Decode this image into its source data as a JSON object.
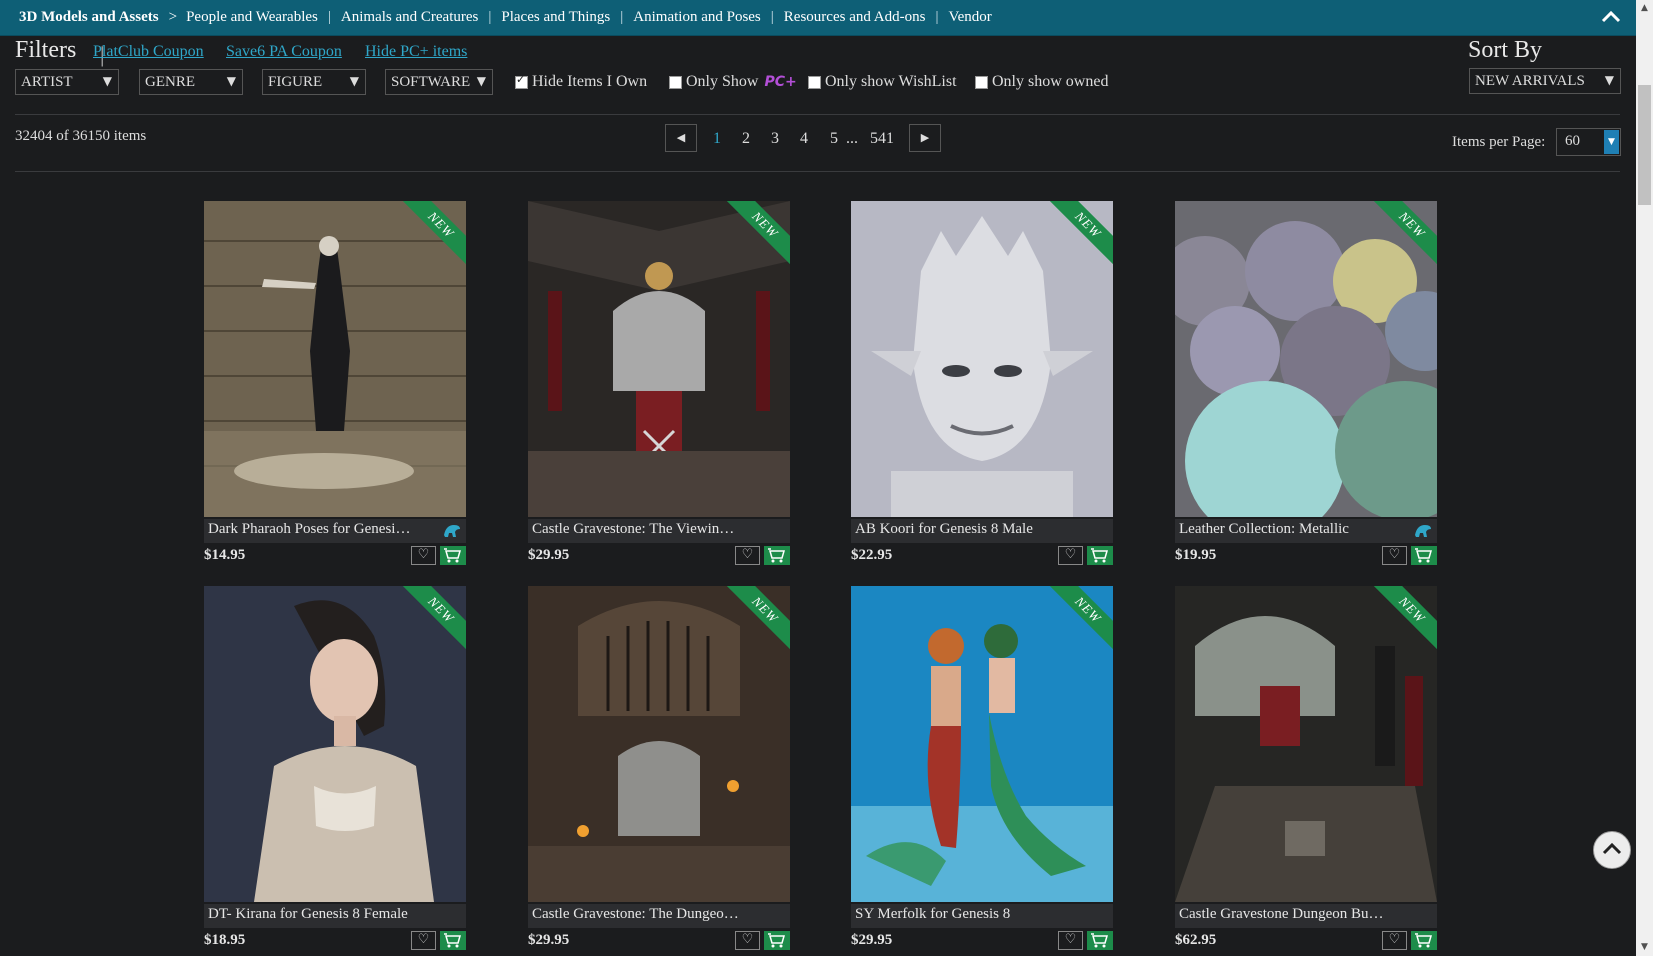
{
  "nav": {
    "home": "3D Models and Assets",
    "separator": ">",
    "items": [
      "People and Wearables",
      "Animals and Creatures",
      "Places and Things",
      "Animation and Poses",
      "Resources and Add-ons",
      "Vendor"
    ]
  },
  "filters": {
    "title": "Filters",
    "coupons": [
      "PlatClub Coupon",
      "Save6 PA Coupon",
      "Hide PC+ items"
    ],
    "dropdowns": [
      "ARTIST",
      "GENRE",
      "FIGURE",
      "SOFTWARE"
    ],
    "checkboxes": [
      {
        "label": "Hide Items I Own",
        "checked": true
      },
      {
        "label": "Only Show",
        "checked": false,
        "badge": "PC+"
      },
      {
        "label": "Only show WishList",
        "checked": false
      },
      {
        "label": "Only show owned",
        "checked": false
      }
    ]
  },
  "sort": {
    "title": "Sort By",
    "value": "NEW ARRIVALS"
  },
  "results": {
    "count_text": "32404 of 36150 items"
  },
  "pagination": {
    "pages": [
      "1",
      "2",
      "3",
      "4",
      "5",
      "...",
      "541"
    ],
    "current": "1",
    "prev_icon": "triangle-left-icon",
    "next_icon": "triangle-right-icon"
  },
  "items_per_page": {
    "label": "Items per Page:",
    "value": "60"
  },
  "products": [
    {
      "title": "Dark Pharaoh Poses for Genesi…",
      "price": "$14.95",
      "badge": "NEW",
      "dinosaur": true
    },
    {
      "title": "Castle Gravestone: The Viewin…",
      "price": "$29.95",
      "badge": "NEW",
      "dinosaur": false
    },
    {
      "title": "AB Koori for Genesis 8 Male",
      "price": "$22.95",
      "badge": "NEW",
      "dinosaur": false
    },
    {
      "title": "Leather Collection: Metallic",
      "price": "$19.95",
      "badge": "NEW",
      "dinosaur": true
    },
    {
      "title": "DT- Kirana for Genesis 8 Female",
      "price": "$18.95",
      "badge": "NEW",
      "dinosaur": false
    },
    {
      "title": "Castle Gravestone: The Dungeo…",
      "price": "$29.95",
      "badge": "NEW",
      "dinosaur": false
    },
    {
      "title": "SY Merfolk for Genesis 8",
      "price": "$29.95",
      "badge": "NEW",
      "dinosaur": false
    },
    {
      "title": "Castle Gravestone Dungeon Bu…",
      "price": "$62.95",
      "badge": "NEW",
      "dinosaur": false
    }
  ],
  "colors": {
    "nav_bg": "#0e5f76",
    "link": "#2fa7c9",
    "badge_green": "#1d8c4a",
    "page_bg": "#1b1c1e",
    "pc_plus": "#b44fd8"
  }
}
